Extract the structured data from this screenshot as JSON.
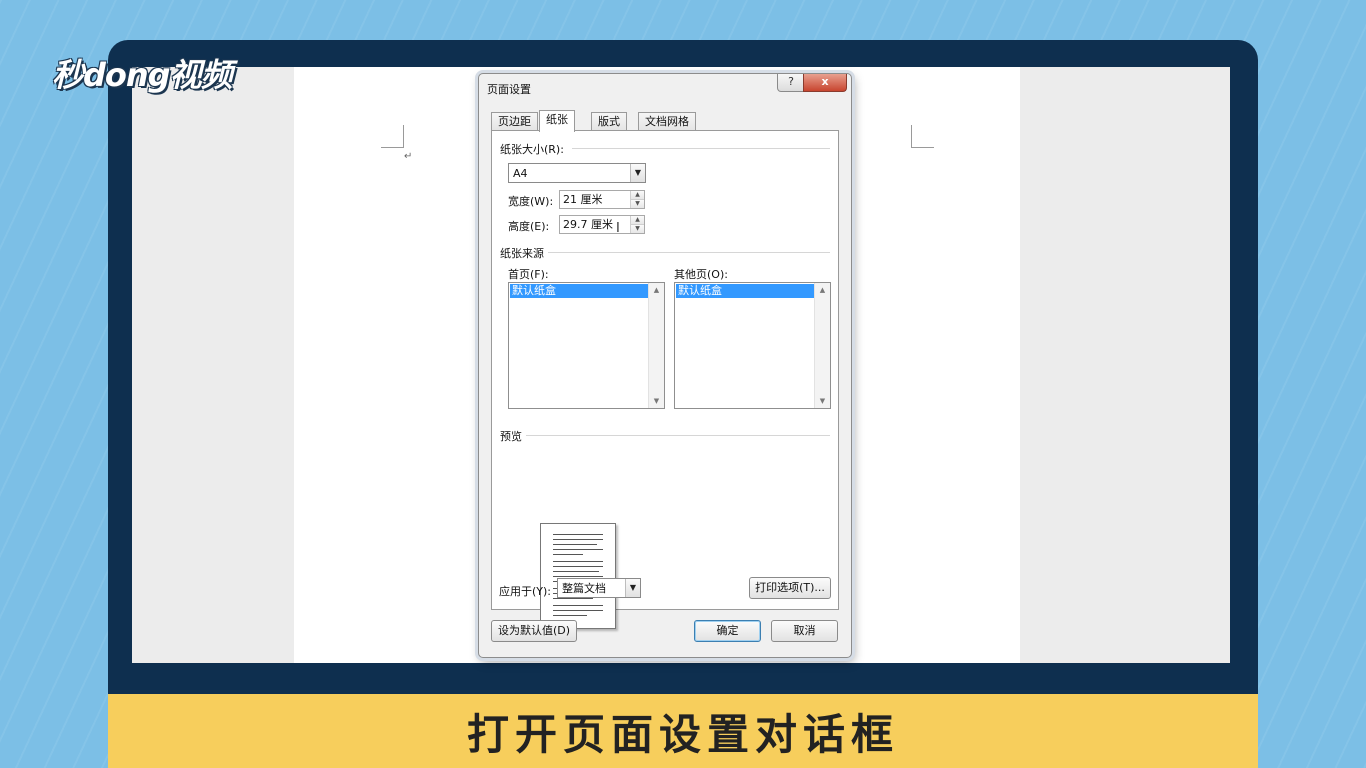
{
  "watermark": {
    "logo_text": "秒dong视频"
  },
  "caption": {
    "text": "打开页面设置对话框"
  },
  "document": {
    "paragraph_mark": "↵"
  },
  "dialog": {
    "title": "页面设置",
    "help_label": "?",
    "close_label": "x",
    "tabs": [
      {
        "label": "页边距"
      },
      {
        "label": "纸张",
        "active": true
      },
      {
        "label": "版式"
      },
      {
        "label": "文档网格"
      }
    ],
    "paper_size": {
      "group_label": "纸张大小(R):",
      "selected": "A4",
      "width_label": "宽度(W):",
      "width_value": "21 厘米",
      "height_label": "高度(E):",
      "height_value": "29.7 厘米"
    },
    "paper_source": {
      "group_label": "纸张来源",
      "first_page_label": "首页(F):",
      "first_page_selected": "默认纸盒",
      "other_pages_label": "其他页(O):",
      "other_pages_selected": "默认纸盒"
    },
    "preview": {
      "group_label": "预览"
    },
    "apply_to": {
      "label": "应用于(Y):",
      "selected": "整篇文档"
    },
    "print_options_label": "打印选项(T)...",
    "set_default_label": "设为默认值(D)",
    "ok_label": "确定",
    "cancel_label": "取消"
  }
}
